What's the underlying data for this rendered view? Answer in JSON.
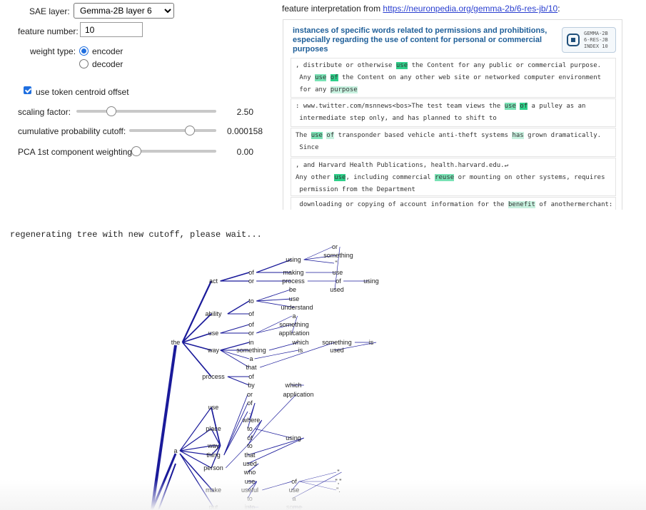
{
  "controls": {
    "sae_layer_label": "SAE layer:",
    "sae_layer_value": "Gemma-2B layer 6",
    "feature_number_label": "feature number:",
    "feature_number_value": "10",
    "weight_type_label": "weight type:",
    "weight_type_options": [
      "encoder",
      "decoder"
    ],
    "weight_type_selected": "encoder",
    "token_centroid_label": "use token centroid offset",
    "token_centroid_checked": true,
    "sliders": [
      {
        "label": "scaling factor:",
        "value": "2.50",
        "fraction": 0.25
      },
      {
        "label": "cumulative probability cutoff:",
        "value": "0.000158",
        "fraction": 0.7
      },
      {
        "label": "PCA 1st component weighting",
        "value": "0.00",
        "fraction": 0.0
      }
    ]
  },
  "feature": {
    "header_prefix": "feature interpretation from ",
    "link_text": "https://neuronpedia.org/gemma-2b/6-res-jb/10",
    "header_suffix": ":",
    "title": "instances of specific words related to permissions and prohibitions, especially regarding the use of content for personal or commercial purposes",
    "badge_text": "GEMMA-2B\n6-RES-JB\nINDEX 10",
    "badge_icon": "cpu-icon",
    "examples": [
      [
        [
          [
            ", distribute or otherwise ",
            0
          ],
          [
            "use",
            1
          ],
          [
            " the Content for any public or commercial purpose.",
            0
          ]
        ],
        [
          [
            " Any ",
            0
          ],
          [
            "use",
            2
          ],
          [
            " ",
            0
          ],
          [
            "of",
            1
          ],
          [
            " the Content on any other web site or networked computer environment",
            0
          ]
        ],
        [
          [
            " for any ",
            0
          ],
          [
            "purpose",
            3
          ]
        ]
      ],
      [
        [
          [
            ": www.twitter.com/msnnews<bos>The test team views the ",
            0
          ],
          [
            "use",
            2
          ],
          [
            " ",
            0
          ],
          [
            "of",
            1
          ],
          [
            " a pulley as an",
            0
          ]
        ],
        [
          [
            " intermediate step only, and has planned to shift to",
            0
          ]
        ]
      ],
      [
        [
          [
            "The ",
            0
          ],
          [
            "use",
            2
          ],
          [
            " ",
            0
          ],
          [
            "of",
            3
          ],
          [
            " transponder based vehicle anti-theft systems ",
            0
          ],
          [
            "has",
            3
          ],
          [
            " grown dramatically.",
            0
          ]
        ],
        [
          [
            " Since",
            0
          ]
        ]
      ],
      [
        [
          [
            ", and Harvard Health Publications, health.harvard.edu.↵",
            0
          ]
        ],
        [
          [
            "Any other ",
            0
          ],
          [
            "use",
            1
          ],
          [
            ", including commercial ",
            0
          ],
          [
            "reuse",
            2
          ],
          [
            " or mounting on other systems, requires",
            0
          ]
        ],
        [
          [
            " permission from the Department",
            0
          ]
        ]
      ],
      [
        [
          [
            " downloading or copying of account information for the ",
            0
          ],
          [
            "benefit",
            3
          ],
          [
            " of anothermerchant:",
            0
          ]
        ]
      ]
    ]
  },
  "status_text": "regenerating tree with new cutoff, please wait...",
  "tree": {
    "nodes": [
      "the",
      "act",
      "ability",
      "use",
      "way",
      "process",
      "of",
      "or",
      "using",
      "making",
      "process",
      "or",
      "something",
      "\"",
      "use",
      "of",
      "using",
      "used",
      "to",
      "of",
      "be",
      "use",
      "understand",
      "used",
      "of",
      "or",
      "application",
      "something",
      "a",
      "in",
      "something",
      "which",
      "is",
      "something",
      "is",
      "used",
      "a",
      "that",
      "of",
      "by",
      "which",
      "application",
      "a",
      "use",
      "or",
      "of",
      ".",
      "place",
      "where",
      "to",
      "way",
      "of",
      "to",
      "using",
      "thing",
      "that",
      "person",
      "used",
      "who",
      "make",
      "use",
      "useful",
      "of",
      "use",
      "to",
      "a",
      "\"",
      "\",\"",
      "\".",
      "put",
      "into",
      "some"
    ]
  }
}
